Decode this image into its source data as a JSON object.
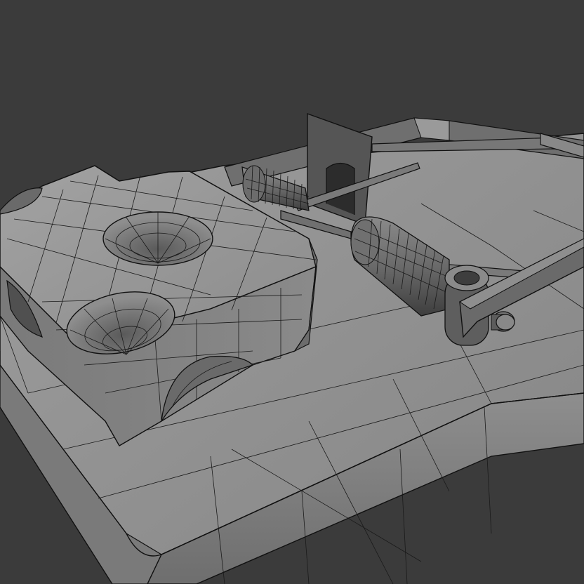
{
  "viewport": {
    "background": "#3b3b3b",
    "model": "mousetrap-wireframe"
  },
  "colors": {
    "surface_light": "#9a9a9a",
    "surface_mid": "#808080",
    "surface_dark": "#5c5c5c",
    "wire": "#1a1a1a"
  }
}
